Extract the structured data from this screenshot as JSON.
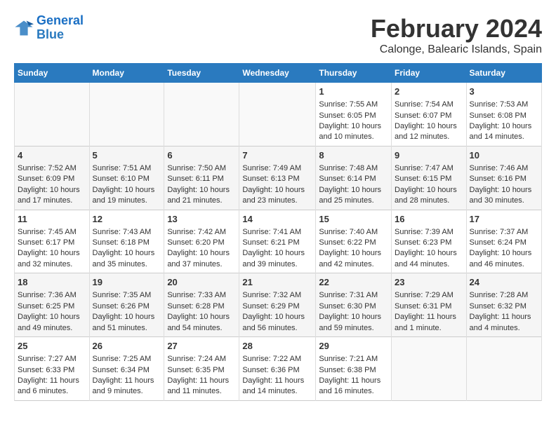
{
  "logo": {
    "line1": "General",
    "line2": "Blue"
  },
  "title": "February 2024",
  "subtitle": "Calonge, Balearic Islands, Spain",
  "days_header": [
    "Sunday",
    "Monday",
    "Tuesday",
    "Wednesday",
    "Thursday",
    "Friday",
    "Saturday"
  ],
  "weeks": [
    [
      {
        "day": "",
        "content": ""
      },
      {
        "day": "",
        "content": ""
      },
      {
        "day": "",
        "content": ""
      },
      {
        "day": "",
        "content": ""
      },
      {
        "day": "1",
        "content": "Sunrise: 7:55 AM\nSunset: 6:05 PM\nDaylight: 10 hours\nand 10 minutes."
      },
      {
        "day": "2",
        "content": "Sunrise: 7:54 AM\nSunset: 6:07 PM\nDaylight: 10 hours\nand 12 minutes."
      },
      {
        "day": "3",
        "content": "Sunrise: 7:53 AM\nSunset: 6:08 PM\nDaylight: 10 hours\nand 14 minutes."
      }
    ],
    [
      {
        "day": "4",
        "content": "Sunrise: 7:52 AM\nSunset: 6:09 PM\nDaylight: 10 hours\nand 17 minutes."
      },
      {
        "day": "5",
        "content": "Sunrise: 7:51 AM\nSunset: 6:10 PM\nDaylight: 10 hours\nand 19 minutes."
      },
      {
        "day": "6",
        "content": "Sunrise: 7:50 AM\nSunset: 6:11 PM\nDaylight: 10 hours\nand 21 minutes."
      },
      {
        "day": "7",
        "content": "Sunrise: 7:49 AM\nSunset: 6:13 PM\nDaylight: 10 hours\nand 23 minutes."
      },
      {
        "day": "8",
        "content": "Sunrise: 7:48 AM\nSunset: 6:14 PM\nDaylight: 10 hours\nand 25 minutes."
      },
      {
        "day": "9",
        "content": "Sunrise: 7:47 AM\nSunset: 6:15 PM\nDaylight: 10 hours\nand 28 minutes."
      },
      {
        "day": "10",
        "content": "Sunrise: 7:46 AM\nSunset: 6:16 PM\nDaylight: 10 hours\nand 30 minutes."
      }
    ],
    [
      {
        "day": "11",
        "content": "Sunrise: 7:45 AM\nSunset: 6:17 PM\nDaylight: 10 hours\nand 32 minutes."
      },
      {
        "day": "12",
        "content": "Sunrise: 7:43 AM\nSunset: 6:18 PM\nDaylight: 10 hours\nand 35 minutes."
      },
      {
        "day": "13",
        "content": "Sunrise: 7:42 AM\nSunset: 6:20 PM\nDaylight: 10 hours\nand 37 minutes."
      },
      {
        "day": "14",
        "content": "Sunrise: 7:41 AM\nSunset: 6:21 PM\nDaylight: 10 hours\nand 39 minutes."
      },
      {
        "day": "15",
        "content": "Sunrise: 7:40 AM\nSunset: 6:22 PM\nDaylight: 10 hours\nand 42 minutes."
      },
      {
        "day": "16",
        "content": "Sunrise: 7:39 AM\nSunset: 6:23 PM\nDaylight: 10 hours\nand 44 minutes."
      },
      {
        "day": "17",
        "content": "Sunrise: 7:37 AM\nSunset: 6:24 PM\nDaylight: 10 hours\nand 46 minutes."
      }
    ],
    [
      {
        "day": "18",
        "content": "Sunrise: 7:36 AM\nSunset: 6:25 PM\nDaylight: 10 hours\nand 49 minutes."
      },
      {
        "day": "19",
        "content": "Sunrise: 7:35 AM\nSunset: 6:26 PM\nDaylight: 10 hours\nand 51 minutes."
      },
      {
        "day": "20",
        "content": "Sunrise: 7:33 AM\nSunset: 6:28 PM\nDaylight: 10 hours\nand 54 minutes."
      },
      {
        "day": "21",
        "content": "Sunrise: 7:32 AM\nSunset: 6:29 PM\nDaylight: 10 hours\nand 56 minutes."
      },
      {
        "day": "22",
        "content": "Sunrise: 7:31 AM\nSunset: 6:30 PM\nDaylight: 10 hours\nand 59 minutes."
      },
      {
        "day": "23",
        "content": "Sunrise: 7:29 AM\nSunset: 6:31 PM\nDaylight: 11 hours\nand 1 minute."
      },
      {
        "day": "24",
        "content": "Sunrise: 7:28 AM\nSunset: 6:32 PM\nDaylight: 11 hours\nand 4 minutes."
      }
    ],
    [
      {
        "day": "25",
        "content": "Sunrise: 7:27 AM\nSunset: 6:33 PM\nDaylight: 11 hours\nand 6 minutes."
      },
      {
        "day": "26",
        "content": "Sunrise: 7:25 AM\nSunset: 6:34 PM\nDaylight: 11 hours\nand 9 minutes."
      },
      {
        "day": "27",
        "content": "Sunrise: 7:24 AM\nSunset: 6:35 PM\nDaylight: 11 hours\nand 11 minutes."
      },
      {
        "day": "28",
        "content": "Sunrise: 7:22 AM\nSunset: 6:36 PM\nDaylight: 11 hours\nand 14 minutes."
      },
      {
        "day": "29",
        "content": "Sunrise: 7:21 AM\nSunset: 6:38 PM\nDaylight: 11 hours\nand 16 minutes."
      },
      {
        "day": "",
        "content": ""
      },
      {
        "day": "",
        "content": ""
      }
    ]
  ]
}
